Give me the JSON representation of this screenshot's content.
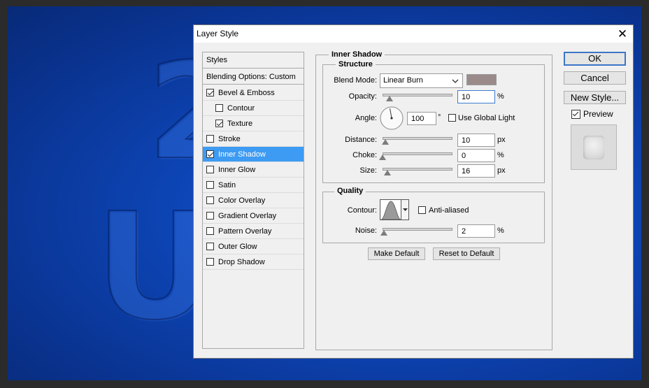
{
  "background_art": {
    "glyph_top": "2",
    "glyph_bottom": "UI"
  },
  "dialog": {
    "title": "Layer Style",
    "close_glyph": "✕"
  },
  "styles_panel": {
    "header": "Styles",
    "blending": "Blending Options: Custom",
    "items": [
      {
        "label": "Bevel & Emboss",
        "checked": true,
        "indent": false,
        "selected": false
      },
      {
        "label": "Contour",
        "checked": false,
        "indent": true,
        "selected": false
      },
      {
        "label": "Texture",
        "checked": true,
        "indent": true,
        "selected": false
      },
      {
        "label": "Stroke",
        "checked": false,
        "indent": false,
        "selected": false
      },
      {
        "label": "Inner Shadow",
        "checked": true,
        "indent": false,
        "selected": true
      },
      {
        "label": "Inner Glow",
        "checked": false,
        "indent": false,
        "selected": false
      },
      {
        "label": "Satin",
        "checked": false,
        "indent": false,
        "selected": false
      },
      {
        "label": "Color Overlay",
        "checked": false,
        "indent": false,
        "selected": false
      },
      {
        "label": "Gradient Overlay",
        "checked": false,
        "indent": false,
        "selected": false
      },
      {
        "label": "Pattern Overlay",
        "checked": false,
        "indent": false,
        "selected": false
      },
      {
        "label": "Outer Glow",
        "checked": false,
        "indent": false,
        "selected": false
      },
      {
        "label": "Drop Shadow",
        "checked": false,
        "indent": false,
        "selected": false
      }
    ]
  },
  "inner_shadow": {
    "title": "Inner Shadow",
    "structure": {
      "title": "Structure",
      "blend_mode_label": "Blend Mode:",
      "blend_mode_value": "Linear Burn",
      "swatch_color": "#9b8a8a",
      "opacity_label": "Opacity:",
      "opacity_value": "10",
      "opacity_level": 0.1,
      "percent": "%",
      "angle_label": "Angle:",
      "angle_value": "100",
      "degree": "°",
      "use_global_light": "Use Global Light",
      "distance_label": "Distance:",
      "distance_value": "10",
      "distance_level": 0.04,
      "choke_label": "Choke:",
      "choke_value": "0",
      "choke_level": 0.0,
      "size_label": "Size:",
      "size_value": "16",
      "size_level": 0.065,
      "px": "px"
    },
    "quality": {
      "title": "Quality",
      "contour_label": "Contour:",
      "anti_aliased": "Anti-aliased",
      "noise_label": "Noise:",
      "noise_value": "2",
      "noise_level": 0.02,
      "percent": "%"
    },
    "make_default": "Make Default",
    "reset_default": "Reset to Default"
  },
  "actions": {
    "ok": "OK",
    "cancel": "Cancel",
    "new_style": "New Style...",
    "preview": "Preview"
  }
}
